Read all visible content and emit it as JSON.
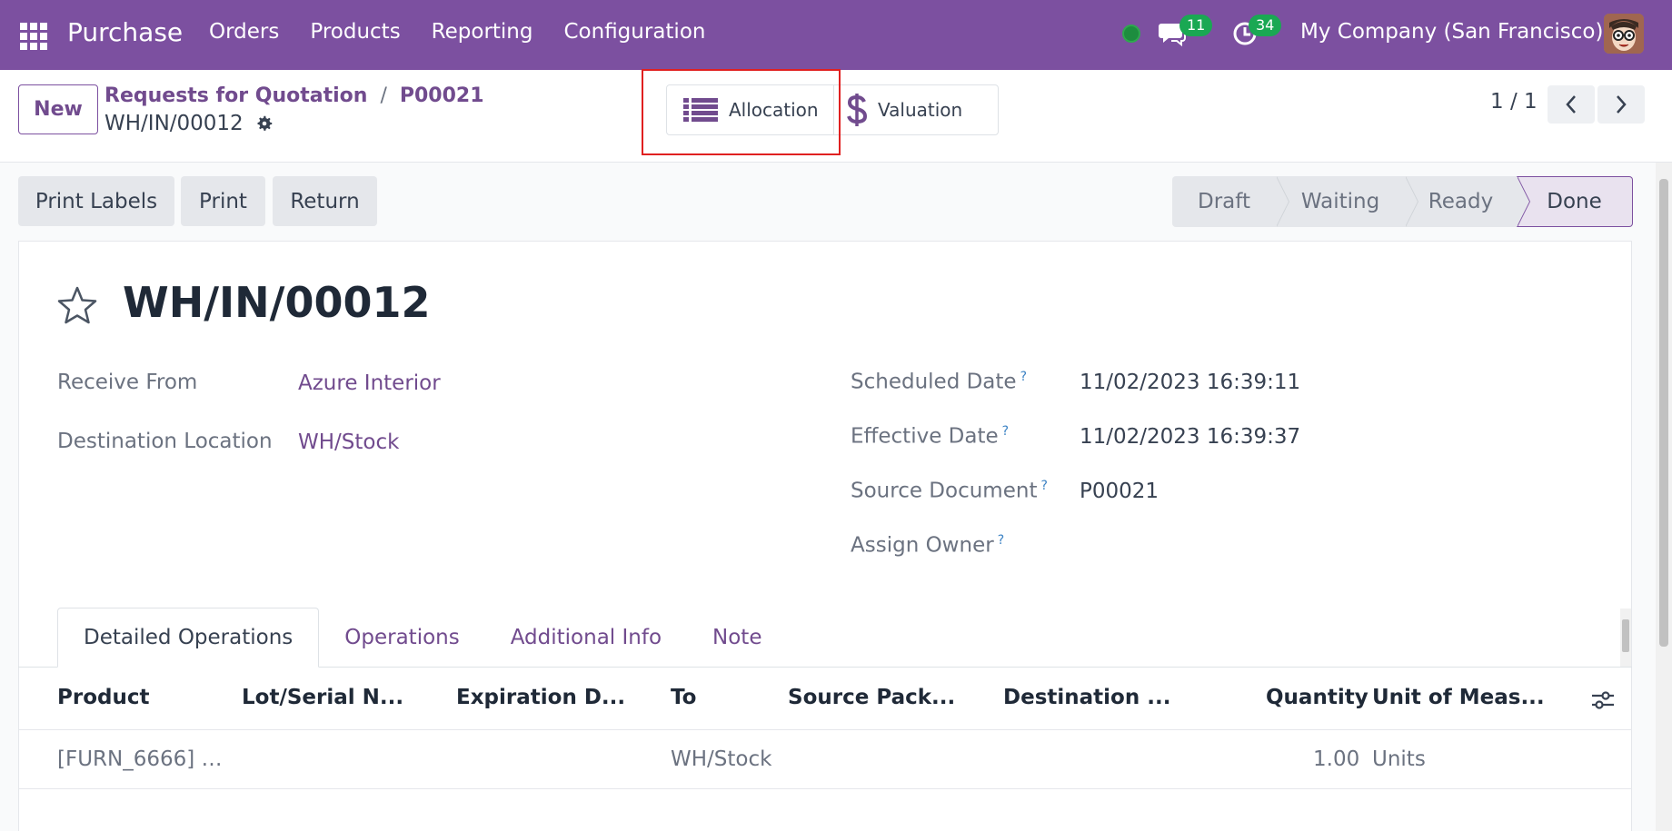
{
  "navbar": {
    "app_name": "Purchase",
    "menu": [
      "Orders",
      "Products",
      "Reporting",
      "Configuration"
    ],
    "chat_count": "11",
    "activity_count": "34",
    "company": "My Company (San Francisco)"
  },
  "control": {
    "new_label": "New",
    "breadcrumb": [
      "Requests for Quotation",
      "P00021"
    ],
    "breadcrumb_sep": "/",
    "record_name": "WH/IN/00012",
    "smart_buttons": {
      "allocation": "Allocation",
      "valuation": "Valuation"
    },
    "pager": "1 / 1"
  },
  "actions": {
    "print_labels": "Print Labels",
    "print": "Print",
    "return": "Return"
  },
  "statusbar": {
    "stages": [
      "Draft",
      "Waiting",
      "Ready",
      "Done"
    ],
    "current": "Done"
  },
  "form": {
    "title": "WH/IN/00012",
    "receive_from_label": "Receive From",
    "receive_from": "Azure Interior",
    "destination_location_label": "Destination Location",
    "destination_location": "WH/Stock",
    "scheduled_date_label": "Scheduled Date",
    "scheduled_date": "11/02/2023 16:39:11",
    "effective_date_label": "Effective Date",
    "effective_date": "11/02/2023 16:39:37",
    "source_document_label": "Source Document",
    "source_document": "P00021",
    "assign_owner_label": "Assign Owner",
    "help_mark": "?"
  },
  "tabs": [
    "Detailed Operations",
    "Operations",
    "Additional Info",
    "Note"
  ],
  "table": {
    "columns": [
      "Product",
      "Lot/Serial N...",
      "Expiration D...",
      "To",
      "Source Pack...",
      "Destination ...",
      "Quantity",
      "Unit of Meas..."
    ],
    "rows": [
      {
        "product": "[FURN_6666] …",
        "lot": "",
        "expiration": "",
        "to": "WH/Stock",
        "source_pack": "",
        "destination": "",
        "quantity": "1.00",
        "uom": "Units"
      }
    ]
  },
  "colors": {
    "brand": "#7c50a0",
    "link": "#714b8e",
    "badge": "#1aa853",
    "highlight": "#e02020"
  }
}
